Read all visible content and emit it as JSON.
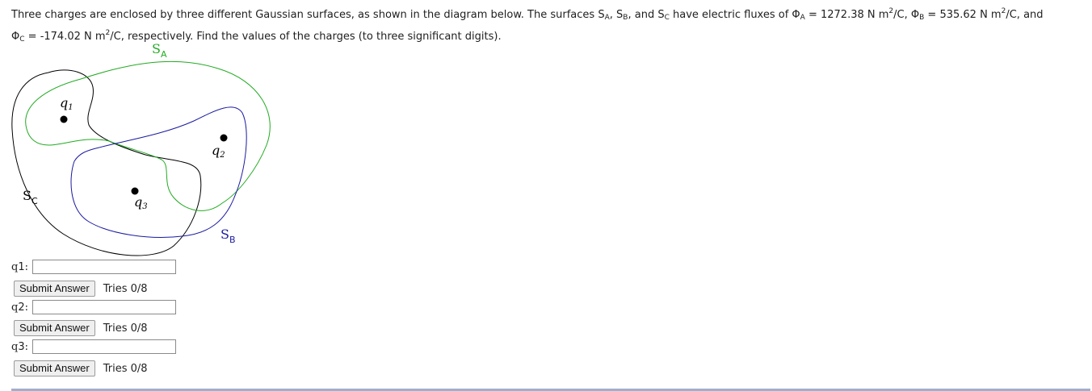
{
  "problem": {
    "part1": "Three charges are enclosed by three different Gaussian surfaces, as shown in the diagram below. The surfaces S",
    "sA": "A",
    "sep1": ", S",
    "sB": "B",
    "sep2": ", and S",
    "sC": "C",
    "part2": " have electric fluxes of Φ",
    "phiA_sub": "A",
    "phiA_val": " = 1272.38 N m",
    "phiA_unit": "/C, Φ",
    "phiB_sub": "B",
    "phiB_val": " = 535.62 N m",
    "phiB_unit": "/C, and",
    "phiC_prefix": "Φ",
    "phiC_sub": "C",
    "phiC_val": " = -174.02 N m",
    "phiC_unit": "/C, respectively. Find the values of the charges (to three significant digits).",
    "sq": "2"
  },
  "diagram": {
    "labels": {
      "SA_main": "S",
      "SA_sub": "A",
      "SB_main": "S",
      "SB_sub": "B",
      "SC_main": "S",
      "SC_sub": "C",
      "q1_main": "q",
      "q1_sub": "1",
      "q2_main": "q",
      "q2_sub": "2",
      "q3_main": "q",
      "q3_sub": "3"
    },
    "colors": {
      "SA": "#22aa22",
      "SB": "#1a1aa0",
      "SC": "#000000"
    }
  },
  "answers": [
    {
      "label": "q",
      "sub": "1",
      "colon": ":",
      "value": "",
      "submit_label": "Submit Answer",
      "tries": "Tries 0/8"
    },
    {
      "label": "q",
      "sub": "2",
      "colon": ":",
      "value": "",
      "submit_label": "Submit Answer",
      "tries": "Tries 0/8"
    },
    {
      "label": "q",
      "sub": "3",
      "colon": ":",
      "value": "",
      "submit_label": "Submit Answer",
      "tries": "Tries 0/8"
    }
  ]
}
